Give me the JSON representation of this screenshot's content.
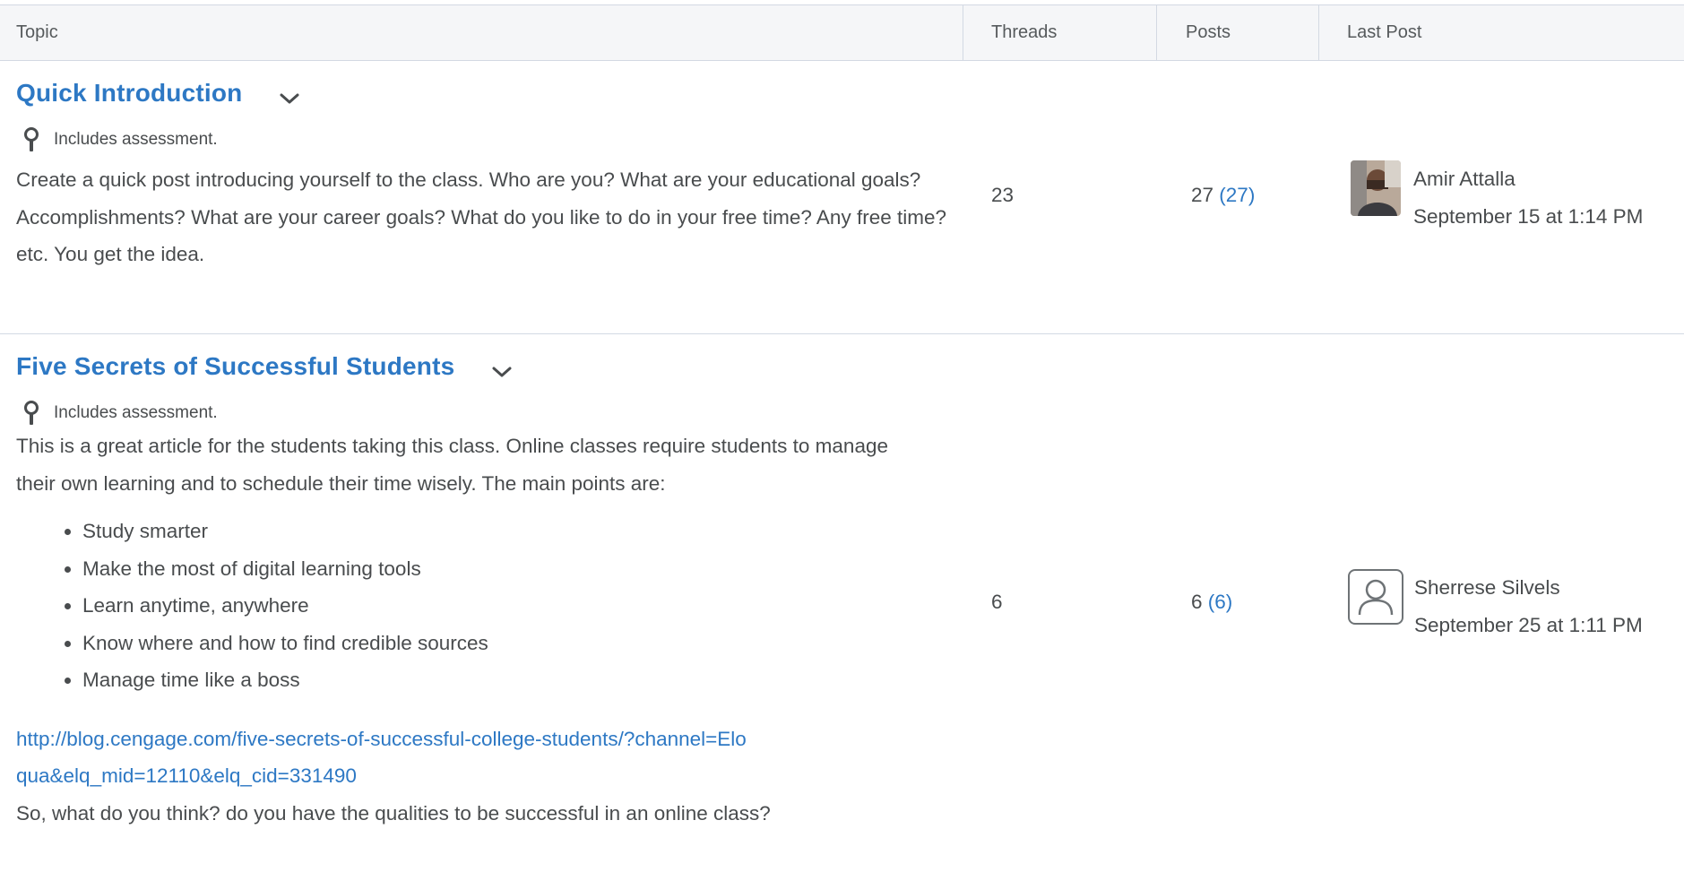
{
  "table": {
    "headers": {
      "topic": "Topic",
      "threads": "Threads",
      "posts": "Posts",
      "last_post": "Last Post"
    },
    "rows": [
      {
        "title": "Quick Introduction",
        "assessment": "Includes assessment.",
        "description": "Create a quick post introducing yourself to the class. Who are you? What are your educational goals? Accomplishments? What are your career goals? What do you like to do in your free time? Any free time? etc. You get the idea.",
        "threads": "23",
        "posts": "27",
        "posts_unread": "(27)",
        "last_post_author": "Amir Attalla",
        "last_post_date": "September 15 at 1:14 PM"
      },
      {
        "title": "Five Secrets of Successful Students",
        "assessment": "Includes assessment.",
        "description": "This is a great article for the students taking this class. Online classes require students to manage their own learning and to schedule their time wisely. The main points are:",
        "bullets": [
          "Study smarter",
          "Make the most of digital learning tools",
          "Learn anytime, anywhere",
          "Know where and how to find credible sources",
          "Manage time like a boss"
        ],
        "link": "http://blog.cengage.com/five-secrets-of-successful-college-students/?channel=Eloqua&elq_mid=12110&elq_cid=331490",
        "closing": "So, what do you think? do you have the qualities to be successful in an online class?",
        "threads": "6",
        "posts": "6",
        "posts_unread": "(6)",
        "last_post_author": "Sherrese Silvels",
        "last_post_date": "September 25 at 1:11 PM"
      }
    ]
  },
  "icons": {
    "assessment": "rubric-pin-icon",
    "expand": "chevron-down-icon",
    "default_avatar": "user-placeholder-icon"
  },
  "colors": {
    "link": "#2d78c4",
    "text": "#494c4e",
    "header_bg": "#f5f6f8",
    "border": "#d3d9e3"
  }
}
